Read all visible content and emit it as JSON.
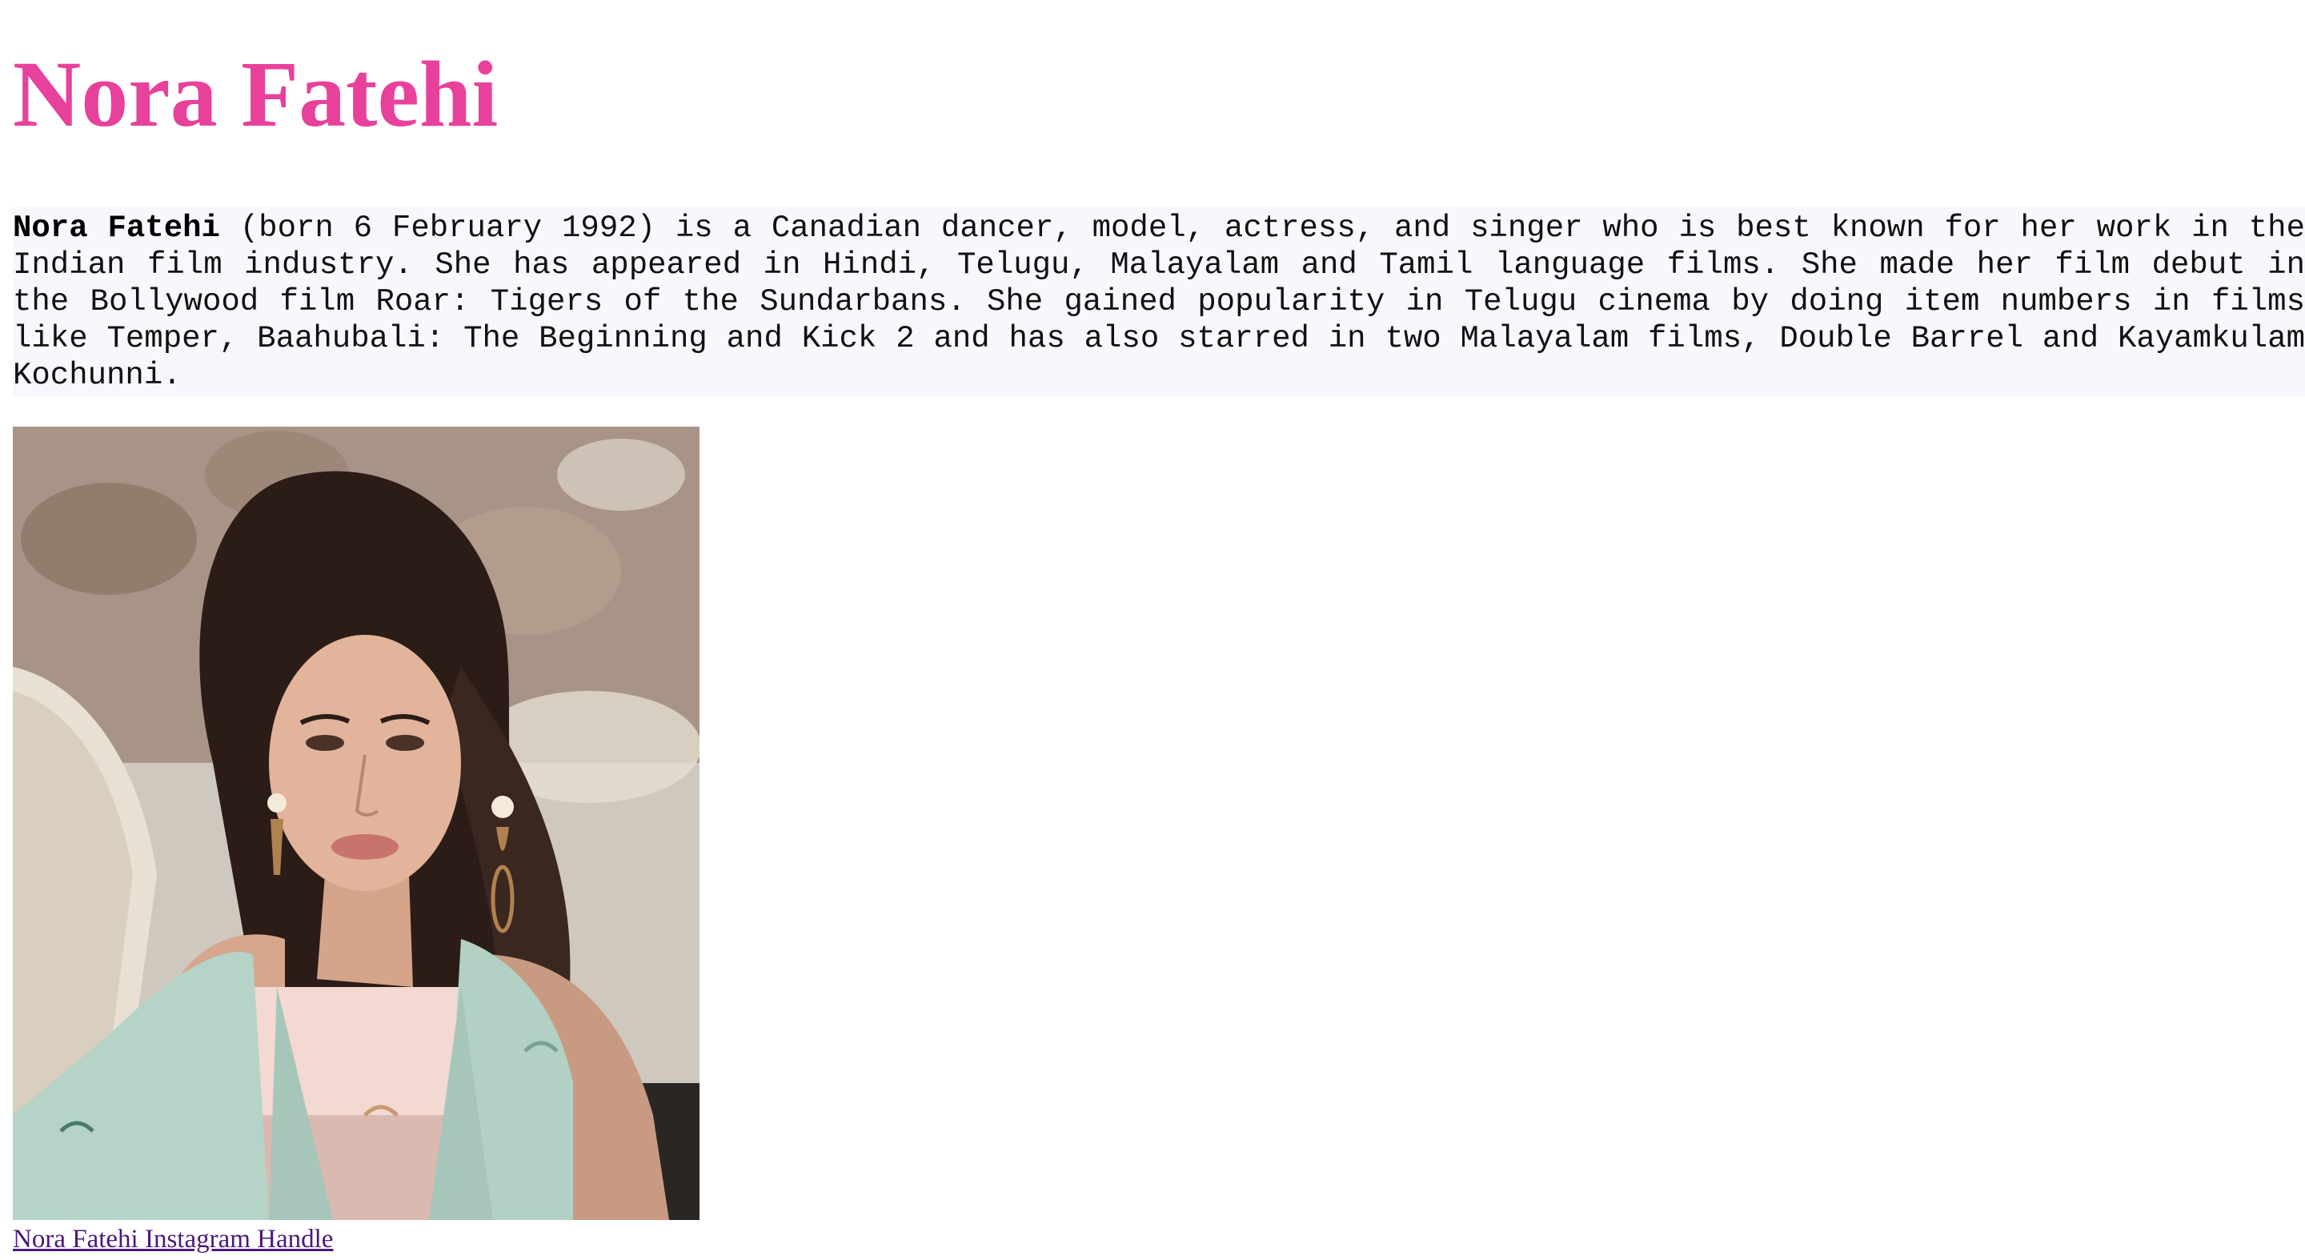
{
  "page": {
    "title": "Nora Fatehi",
    "accent_color": "#e8419c"
  },
  "bio": {
    "name": "Nora Fatehi",
    "text": " (born 6 February 1992) is a Canadian dancer, model, actress, and singer who is best known for her work in the Indian film industry. She has appeared in Hindi, Telugu, Malayalam and Tamil language films. She made her film debut in the Bollywood film Roar: Tigers of the Sundarbans. She gained popularity in Telugu cinema by doing item numbers in films like Temper, Baahubali: The Beginning and Kick 2 and has also starred in two Malayalam films, Double Barrel and Kayamkulam Kochunni."
  },
  "photo": {
    "icon": "portrait-photo"
  },
  "link": {
    "label": "Nora Fatehi Instagram Handle",
    "color": "#4b1a7a"
  }
}
